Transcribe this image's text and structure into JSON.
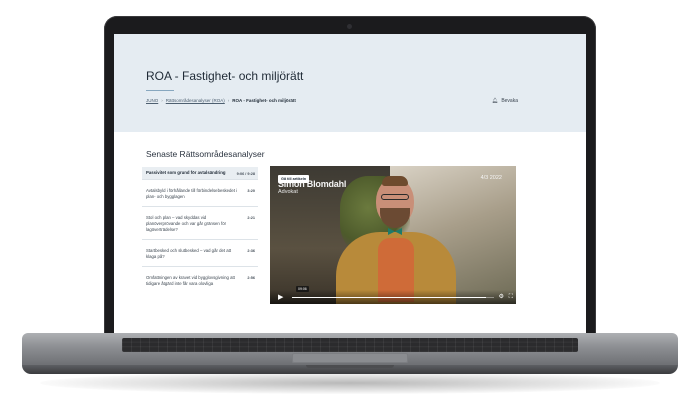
{
  "page": {
    "title": "ROA - Fastighet- och miljörätt",
    "breadcrumb": [
      "JUNO",
      "Rättsområdesanalyser (ROA)",
      "ROA - Fastighet- och miljörätt"
    ],
    "watch_label": "Bevaka"
  },
  "section_title": "Senaste Rättsområdesanalyser",
  "analyses": [
    {
      "title": "Passivitet som grund för avtalsändring",
      "duration": "9:06 / 9:28",
      "active": true
    },
    {
      "title": "Avtalsbyld i förhållande till förbindelsebeskedet i plan- och bygglagen",
      "duration": "3:20",
      "active": false
    },
    {
      "title": "Stol och plan – vad skyddas vid planöverprövande och var går gränsen för lagöverträdelse?",
      "duration": "2:21",
      "active": false
    },
    {
      "title": "Startbesked och slutbesked – vad går det att klaga på?",
      "duration": "2:36",
      "active": false
    },
    {
      "title": "Omfattningen av kravet vid bygglovsgivning att tidigare åtgärd inte får vara olovliga",
      "duration": "2:56",
      "active": false
    }
  ],
  "video": {
    "go_to_article": "Gå till artikeln",
    "speaker_name": "Simon Blomdahl",
    "speaker_role": "Advokat",
    "date": "4/3 2022",
    "time_pill": "09:06",
    "progress": 0.96
  },
  "icons": {
    "watch": "bell-icon",
    "play": "play-icon",
    "settings": "gear-icon",
    "fullscreen": "fullscreen-icon"
  },
  "colors": {
    "hero_bg": "#e5ecf2",
    "title_rule": "#87a7bf",
    "active_item_bg": "#e9eef2"
  }
}
